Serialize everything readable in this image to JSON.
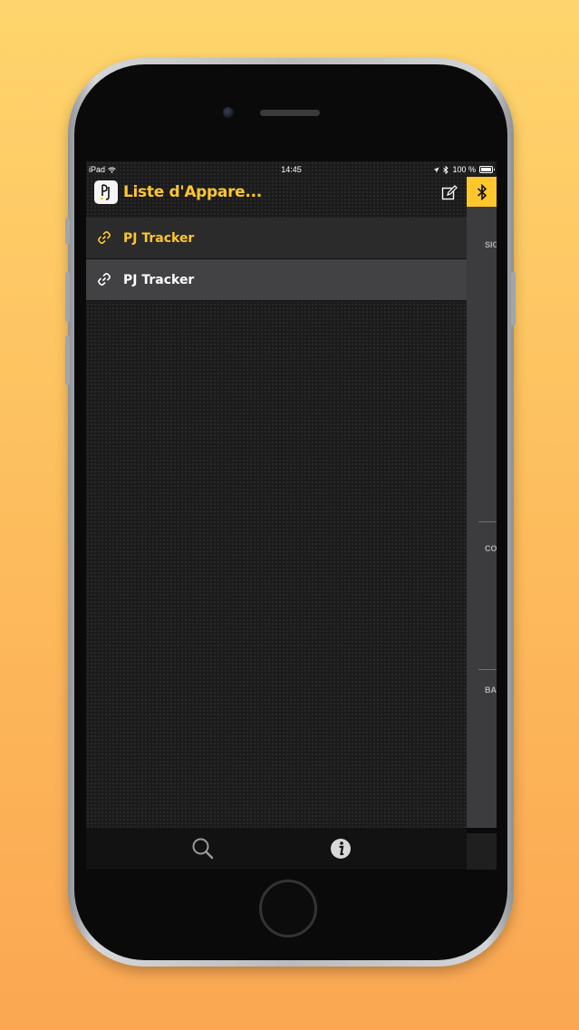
{
  "status_bar": {
    "device": "iPad",
    "time": "14:45",
    "battery": "100 %"
  },
  "navbar": {
    "title": "Liste d'Appare...",
    "edit_icon": "edit-icon",
    "app_icon": "pj-logo-icon"
  },
  "devices": [
    {
      "name": "PJ Tracker",
      "icon": "link-icon",
      "color": "#ffc72c"
    },
    {
      "name": "PJ Tracker",
      "icon": "link-icon",
      "color": "#ffffff"
    }
  ],
  "side_panel": {
    "bluetooth_icon": "bluetooth-icon",
    "labels": [
      "SIG",
      "CO",
      "BA"
    ]
  },
  "tabbar": {
    "search_icon": "search-icon",
    "info_icon": "info-icon"
  },
  "colors": {
    "accent": "#ffc72c",
    "background": "#1b1b1b"
  }
}
